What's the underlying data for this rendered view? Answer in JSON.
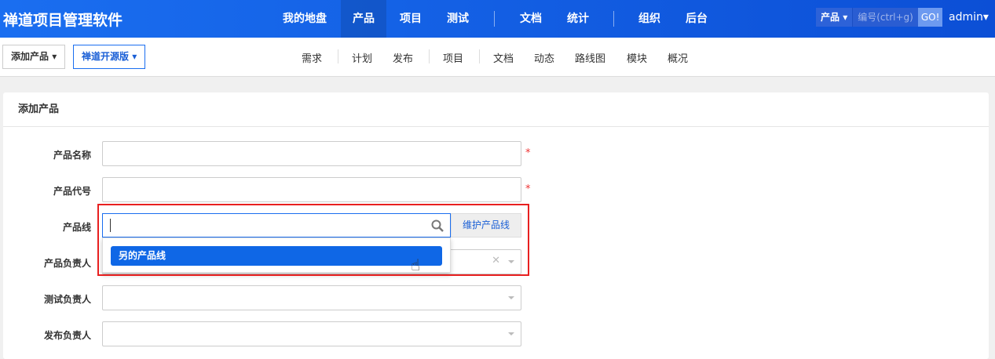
{
  "header": {
    "brand": "禅道项目管理软件",
    "nav": [
      "我的地盘",
      "产品",
      "项目",
      "测试",
      "文档",
      "统计",
      "组织",
      "后台"
    ],
    "search_type": "产品",
    "search_placeholder": "编号(ctrl+g)",
    "go": "GO!",
    "user": "admin"
  },
  "subheader": {
    "crumb1": "添加产品",
    "crumb2": "禅道开源版",
    "nav": [
      "需求",
      "计划",
      "发布",
      "项目",
      "文档",
      "动态",
      "路线图",
      "模块",
      "概况"
    ]
  },
  "form": {
    "title": "添加产品",
    "fields": [
      "产品名称",
      "产品代号",
      "产品线",
      "产品负责人",
      "测试负责人",
      "发布负责人"
    ],
    "required": "*",
    "maintain_line": "维护产品线",
    "option": "另的产品线"
  }
}
